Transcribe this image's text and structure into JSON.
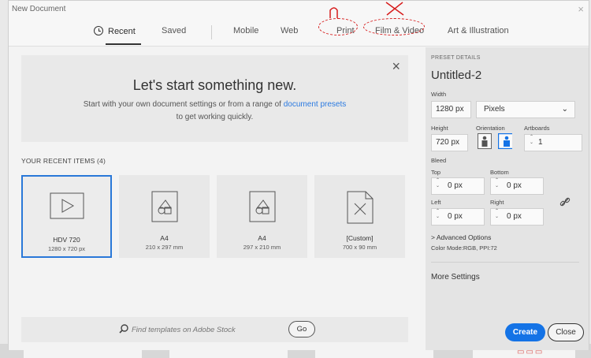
{
  "window": {
    "title": "New Document",
    "close_glyph": "×"
  },
  "tabs": [
    {
      "label": "Recent",
      "icon": "clock-icon",
      "active": true
    },
    {
      "label": "Saved"
    },
    {
      "label": "Mobile"
    },
    {
      "label": "Web"
    },
    {
      "label": "Print"
    },
    {
      "label": "Film & Video"
    },
    {
      "label": "Art & Illustration"
    }
  ],
  "hero": {
    "close_glyph": "×",
    "headline": "Let's start something new.",
    "line1_prefix": "Start with your own document settings or from a range of ",
    "line1_link": "document presets",
    "line2": "to get working quickly."
  },
  "recent": {
    "label": "YOUR RECENT ITEMS  (4)",
    "items": [
      {
        "name": "HDV 720",
        "size": "1280 x 720 px",
        "icon": "video-play-icon",
        "selected": true
      },
      {
        "name": "A4",
        "size": "210 x 297 mm",
        "icon": "print-shapes-icon"
      },
      {
        "name": "A4",
        "size": "297 x 210 mm",
        "icon": "print-shapes-icon"
      },
      {
        "name": "[Custom]",
        "size": "700 x 90 mm",
        "icon": "custom-document-icon"
      }
    ]
  },
  "search": {
    "placeholder": "Find templates on Adobe Stock",
    "go_label": "Go"
  },
  "preset": {
    "section_title": "PRESET DETAILS",
    "doc_name": "Untitled-2",
    "width_label": "Width",
    "width_value": "1280 px",
    "units": "Pixels",
    "height_label": "Height",
    "height_value": "720 px",
    "orientation_label": "Orientation",
    "artboards_label": "Artboards",
    "artboards_value": "1",
    "bleed_label": "Bleed",
    "top_label": "Top",
    "top_value": "0 px",
    "bottom_label": "Bottom",
    "bottom_value": "0 px",
    "left_label": "Left",
    "left_value": "0 px",
    "right_label": "Right",
    "right_value": "0 px",
    "advanced_label": "Advanced Options",
    "color_mode": "Color Mode:RGB, PPI:72",
    "more_settings": "More Settings"
  },
  "buttons": {
    "create": "Create",
    "close": "Close"
  },
  "colors": {
    "accent": "#1473e6",
    "selected_border": "#2a78d8",
    "annotation": "#d61b1b",
    "link": "#2b7ae0"
  }
}
